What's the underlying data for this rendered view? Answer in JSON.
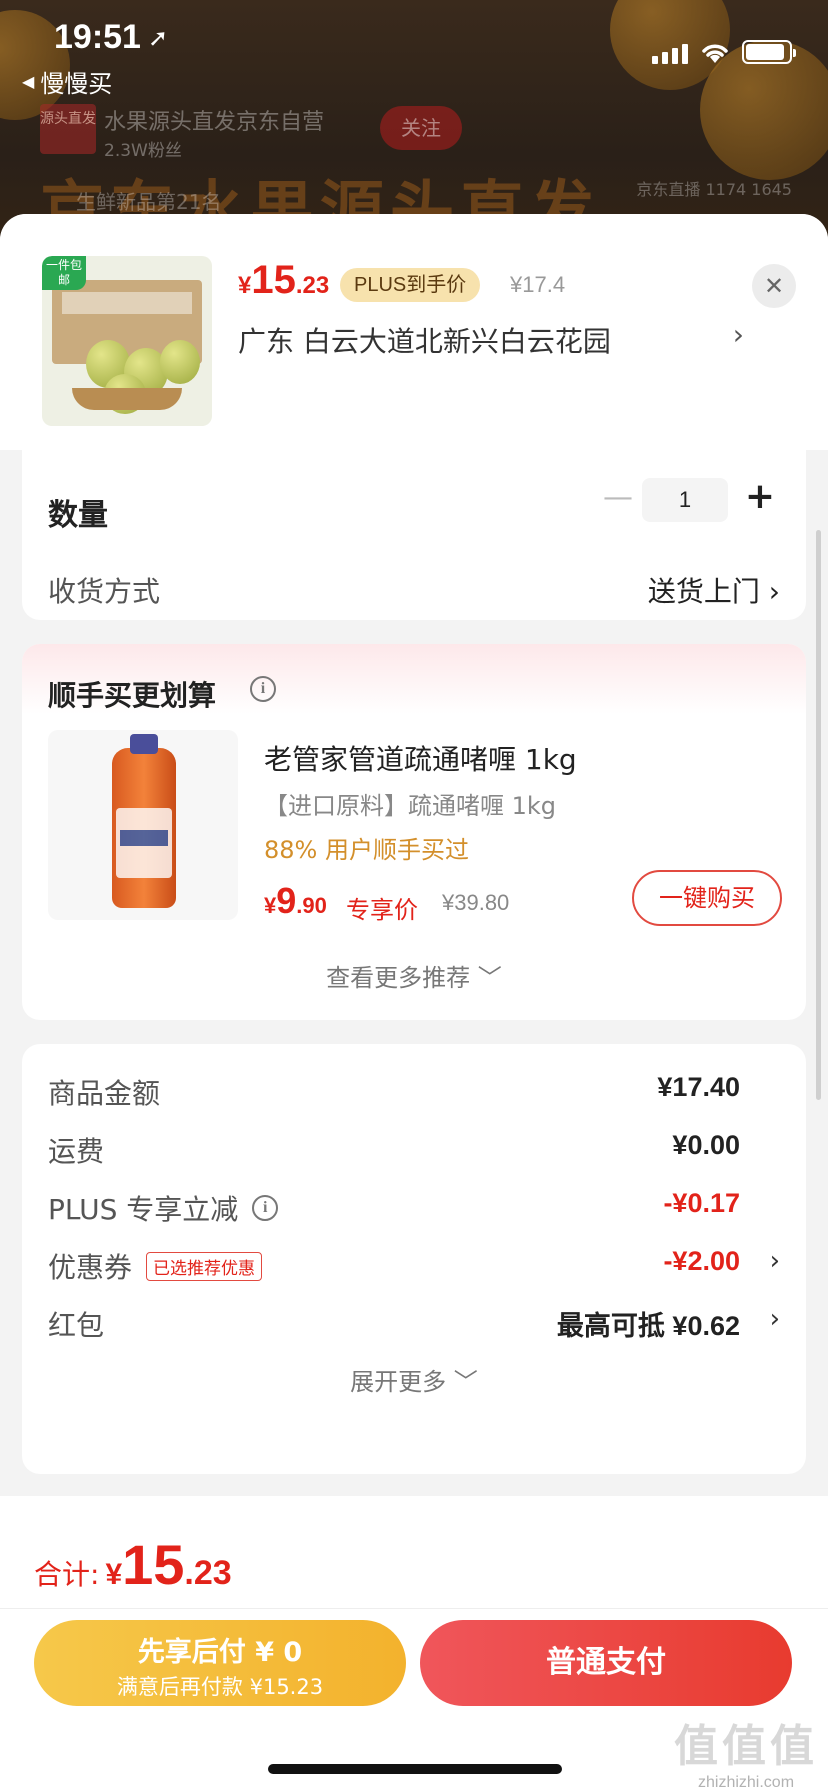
{
  "status_bar": {
    "time": "19:51",
    "location_glyph": "➚"
  },
  "back_nav": {
    "glyph": "◀",
    "label": "慢慢买"
  },
  "background_app": {
    "shop_logo": "源头直发",
    "shop_name": "水果源头直发京东自营",
    "fans": "2.3W粉丝",
    "follow": "关注",
    "banner": "京东水果源头直发",
    "banner_sub": "生鲜新品第21名",
    "live_badge": "京东直播 1174 1645"
  },
  "product": {
    "free_ship": "一件包邮",
    "price_currency": "¥",
    "price_int": "15",
    "price_dec": ".23",
    "plus_tag": "PLUS到手价",
    "orig_price": "¥17.4",
    "address": "广东  白云大道北新兴白云花园",
    "address_chevron": "›",
    "close_glyph": "✕"
  },
  "quantity": {
    "label": "数量",
    "value": "1",
    "minus": "—",
    "plus": "+"
  },
  "shipping": {
    "label": "收货方式",
    "value": "送货上门 ›"
  },
  "recommend": {
    "title": "顺手买更划算",
    "info_glyph": "i",
    "item_name": "老管家管道疏通啫喱 1kg",
    "item_desc": "【进口原料】疏通啫喱 1kg",
    "item_stat": "88% 用户顺手买过",
    "price_currency": "¥",
    "price_int": "9",
    "price_dec": ".90",
    "exclusive": "专享价",
    "orig_price": "¥39.80",
    "buy_button": "一键购买",
    "see_more": "查看更多推荐 ﹀"
  },
  "costs": {
    "goods_amount": {
      "label": "商品金额",
      "value": "¥17.40"
    },
    "freight": {
      "label": "运费",
      "value": "¥0.00"
    },
    "plus_discount": {
      "label": "PLUS 专享立减",
      "value": "-¥0.17"
    },
    "coupon": {
      "label": "优惠券",
      "tag": "已选推荐优惠",
      "value": "-¥2.00"
    },
    "red_packet": {
      "label": "红包",
      "value": "最高可抵 ¥0.62"
    },
    "chevron": "›",
    "expand_more": "展开更多 ﹀"
  },
  "footer": {
    "total_label": "合计:",
    "total_currency": "¥",
    "total_int": "15",
    "total_dec": ".23",
    "pay_later_line1": "先享后付 ¥ 0",
    "pay_later_line2": "满意后再付款 ¥15.23",
    "pay_normal": "普通支付"
  },
  "watermark": {
    "text1": "值值值",
    "text2": "zhizhizhi.com"
  },
  "colors": {
    "accent_red": "#e2231a",
    "plus_gold": "#f7e2ad",
    "pay_later_yellow": "#f6c84a",
    "stat_orange": "#d38f2b"
  }
}
